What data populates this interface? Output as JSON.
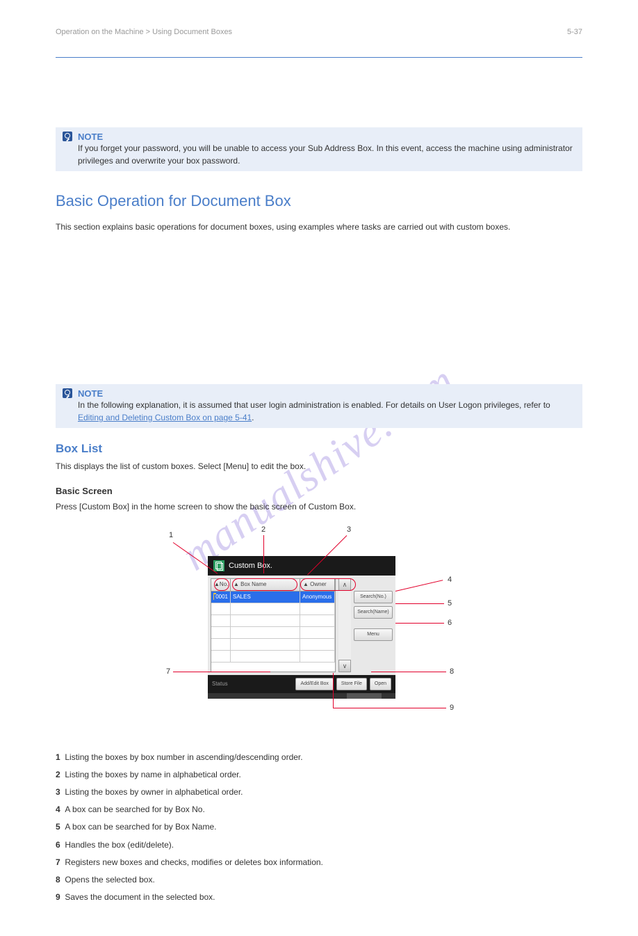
{
  "header": {
    "breadcrumb": "Operation on the Machine > Using Document Boxes",
    "page_number": "5-37"
  },
  "note1": {
    "label": "NOTE",
    "text": "If you forget your password, you will be unable to access your Sub Address Box. In this event, access the machine using administrator privileges and overwrite your box password."
  },
  "section": {
    "title": "Basic Operation for Document Box",
    "intro": "This section explains basic operations for document boxes, using examples where tasks are carried out with custom boxes."
  },
  "note2": {
    "label": "NOTE",
    "text_before": "In the following explanation, it is assumed that user login administration is enabled. For details on User Logon privileges, refer to ",
    "link": "Editing and Deleting Custom Box on page 5-41",
    "text_after": "."
  },
  "boxlist": {
    "title": "Box List",
    "desc": "This displays the list of custom boxes. Select [Menu] to edit the box.",
    "basic_label": "Basic Screen",
    "basic_desc": "Press [Custom Box] in the home screen to show the basic screen of Custom Box."
  },
  "panel": {
    "title": "Custom Box.",
    "col_no": "No.",
    "col_name": "Box Name",
    "col_owner": "Owner",
    "row_no": "0001",
    "row_name": "SALES",
    "row_owner": "Anonymous",
    "scroll_up": "∧",
    "scroll_down": "∨",
    "side_search": "Search(No.)",
    "side_search_name": "Search(Name)",
    "side_menu": "Menu",
    "footer_status": "Status",
    "footer_add": "Add/Edit Box",
    "footer_store": "Store File",
    "footer_open": "Open"
  },
  "callouts": {
    "n1": "1",
    "n2": "2",
    "n3": "3",
    "n4": "4",
    "n5": "5",
    "n6": "6",
    "n7": "7",
    "n8": "8",
    "n9": "9"
  },
  "legend": {
    "l1": "Listing the boxes by box number in ascending/descending order.",
    "l2": "Listing the boxes by name in alphabetical order.",
    "l3": "Listing the boxes by owner in alphabetical order.",
    "l4": "A box can be searched for by Box No.",
    "l5": "A box can be searched for by Box Name.",
    "l6": "Handles the box (edit/delete).",
    "l7": "Registers new boxes and checks, modifies or deletes box information.",
    "l8": "Opens the selected box.",
    "l9": "Saves the document in the selected box."
  },
  "watermark": "manualshive.com"
}
